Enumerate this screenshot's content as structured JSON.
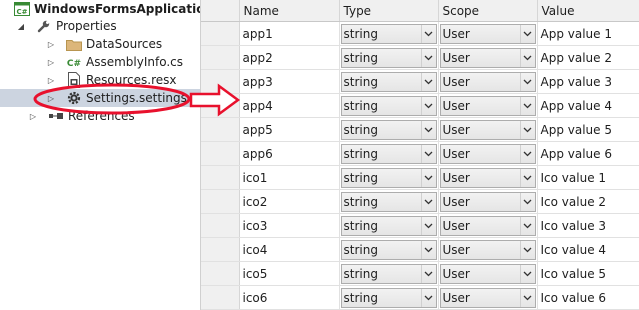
{
  "tree": {
    "project": "WindowsFormsApplication",
    "properties": "Properties",
    "items": [
      {
        "label": "DataSources"
      },
      {
        "label": "AssemblyInfo.cs"
      },
      {
        "label": "Resources.resx"
      },
      {
        "label": "Settings.settings"
      }
    ],
    "references": "References",
    "csharp_badge": "C#"
  },
  "grid": {
    "headers": {
      "name": "Name",
      "type": "Type",
      "scope": "Scope",
      "value": "Value"
    },
    "rows": [
      {
        "name": "app1",
        "type": "string",
        "scope": "User",
        "value": "App value 1"
      },
      {
        "name": "app2",
        "type": "string",
        "scope": "User",
        "value": "App value 2"
      },
      {
        "name": "app3",
        "type": "string",
        "scope": "User",
        "value": "App value 3"
      },
      {
        "name": "app4",
        "type": "string",
        "scope": "User",
        "value": "App value 4"
      },
      {
        "name": "app5",
        "type": "string",
        "scope": "User",
        "value": "App value 5"
      },
      {
        "name": "app6",
        "type": "string",
        "scope": "User",
        "value": "App value 6"
      },
      {
        "name": "ico1",
        "type": "string",
        "scope": "User",
        "value": "Ico value 1"
      },
      {
        "name": "ico2",
        "type": "string",
        "scope": "User",
        "value": "Ico value 2"
      },
      {
        "name": "ico3",
        "type": "string",
        "scope": "User",
        "value": "Ico value 3"
      },
      {
        "name": "ico4",
        "type": "string",
        "scope": "User",
        "value": "Ico value 4"
      },
      {
        "name": "ico5",
        "type": "string",
        "scope": "User",
        "value": "Ico value 5"
      },
      {
        "name": "ico6",
        "type": "string",
        "scope": "User",
        "value": "Ico value 6"
      }
    ]
  },
  "colors": {
    "annotation": "#e8112d",
    "selection": "#ccd4e0",
    "folder": "#dcb67a"
  },
  "icons": [
    "csharp-project-icon",
    "wrench-icon",
    "folder-icon",
    "csharp-file-icon",
    "resx-file-icon",
    "gear-icon",
    "references-icon",
    "dropdown-arrow-icon"
  ]
}
